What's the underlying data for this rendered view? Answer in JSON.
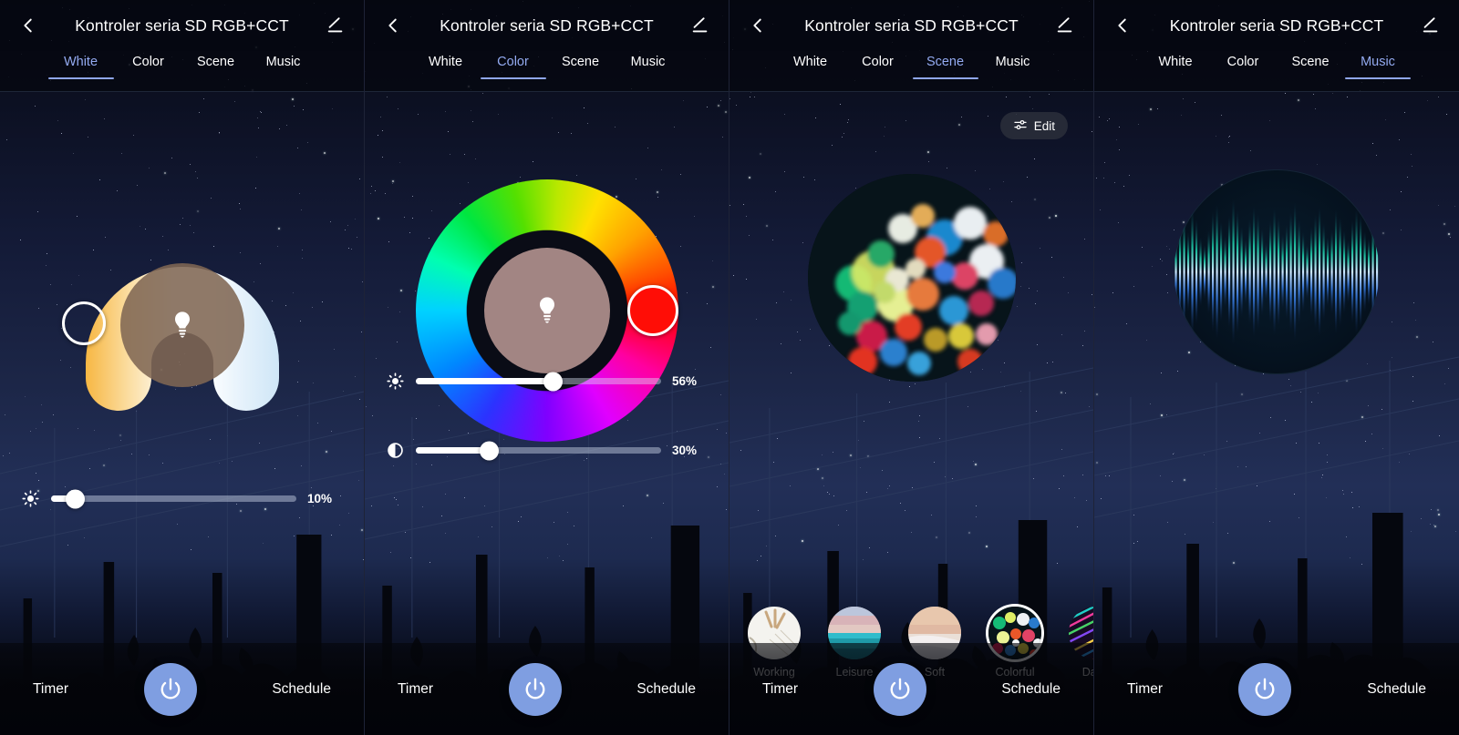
{
  "app": {
    "title": "Kontroler seria SD RGB+CCT",
    "back_icon": "chevron-left-icon",
    "edit_icon": "pencil-edit-icon",
    "bulb_icon": "light-bulb-icon",
    "accent": "#8fa6ec",
    "power_color": "#7f9ee1"
  },
  "tabs": [
    {
      "label": "White"
    },
    {
      "label": "Color"
    },
    {
      "label": "Scene"
    },
    {
      "label": "Music"
    }
  ],
  "bottom": {
    "timer_label": "Timer",
    "schedule_label": "Schedule",
    "power_icon": "power-icon"
  },
  "panels": [
    {
      "id": "white",
      "active_tab": "White",
      "control": "cct-wheel",
      "sliders": [
        {
          "name": "brightness",
          "icon": "brightness-sun-icon",
          "value": 10,
          "value_label": "10%"
        }
      ]
    },
    {
      "id": "color",
      "active_tab": "Color",
      "control": "hue-wheel",
      "selected_color": "#ff0d06",
      "sliders": [
        {
          "name": "brightness",
          "icon": "brightness-sun-icon",
          "value": 56,
          "value_label": "56%"
        },
        {
          "name": "saturation",
          "icon": "contrast-half-circle-icon",
          "value": 30,
          "value_label": "30%"
        }
      ]
    },
    {
      "id": "scene",
      "active_tab": "Scene",
      "control": "scene-preview",
      "edit_button": {
        "label": "Edit",
        "icon": "sliders-adjust-icon"
      },
      "presets": [
        {
          "label": "Working",
          "selected": false,
          "thumb": "desk-notebook-pencils"
        },
        {
          "label": "Leisure",
          "selected": false,
          "thumb": "sea-sunset-horizon"
        },
        {
          "label": "Soft",
          "selected": false,
          "thumb": "soft-dunes-pastel"
        },
        {
          "label": "Colorful",
          "selected": true,
          "thumb": "colorful-bokeh-lights"
        },
        {
          "label": "Dazz",
          "selected": false,
          "thumb": "dazzling-neon-stripes"
        }
      ]
    },
    {
      "id": "music",
      "active_tab": "Music",
      "control": "audio-visualizer",
      "visualizer": {
        "bars": [
          34,
          52,
          61,
          44,
          70,
          58,
          38,
          30,
          46,
          66,
          74,
          55,
          40,
          62,
          80,
          68,
          50,
          36,
          58,
          72,
          64,
          48,
          33,
          56,
          70,
          60,
          42,
          52,
          66,
          76,
          58,
          44,
          31,
          50,
          63,
          71,
          54,
          39,
          47,
          68,
          60,
          46,
          35,
          57,
          69,
          62,
          45,
          37,
          53,
          65
        ]
      }
    }
  ]
}
